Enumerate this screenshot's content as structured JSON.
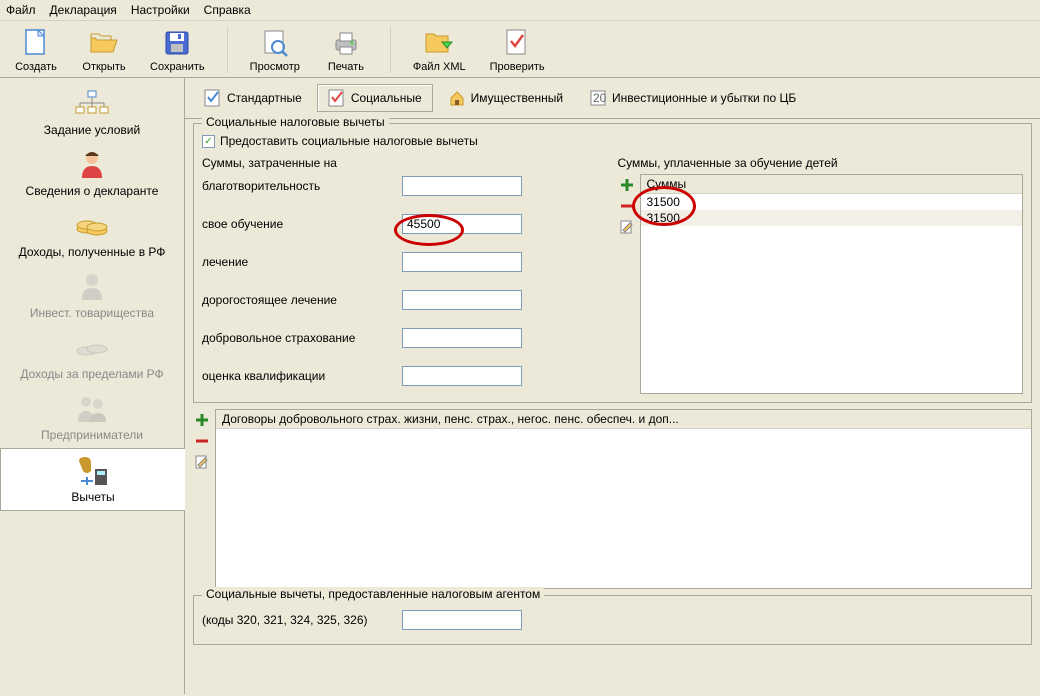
{
  "menubar": [
    "Файл",
    "Декларация",
    "Настройки",
    "Справка"
  ],
  "toolbar": [
    {
      "label": "Создать",
      "icon": "new-icon"
    },
    {
      "label": "Открыть",
      "icon": "open-icon"
    },
    {
      "label": "Сохранить",
      "icon": "save-icon"
    },
    {
      "label": "Просмотр",
      "icon": "preview-icon"
    },
    {
      "label": "Печать",
      "icon": "print-icon"
    },
    {
      "label": "Файл XML",
      "icon": "xml-icon"
    },
    {
      "label": "Проверить",
      "icon": "check-icon"
    }
  ],
  "sidebar": [
    {
      "label": "Задание условий",
      "icon": "conditions-icon",
      "enabled": true
    },
    {
      "label": "Сведения о декларанте",
      "icon": "declarant-icon",
      "enabled": true
    },
    {
      "label": "Доходы, полученные в РФ",
      "icon": "income-rf-icon",
      "enabled": true
    },
    {
      "label": "Инвест. товарищества",
      "icon": "invest-icon",
      "enabled": false
    },
    {
      "label": "Доходы за пределами РФ",
      "icon": "income-abroad-icon",
      "enabled": false
    },
    {
      "label": "Предприниматели",
      "icon": "entrepreneur-icon",
      "enabled": false
    },
    {
      "label": "Вычеты",
      "icon": "deductions-icon",
      "enabled": true,
      "selected": true
    }
  ],
  "tabs": [
    {
      "label": "Стандартные",
      "icon": "standard-icon"
    },
    {
      "label": "Социальные",
      "icon": "social-icon",
      "active": true
    },
    {
      "label": "Имущественный",
      "icon": "property-icon"
    },
    {
      "label": "Инвестиционные и убытки по ЦБ",
      "icon": "investment-icon"
    }
  ],
  "groupTitle": "Социальные налоговые вычеты",
  "checkboxLabel": "Предоставить социальные налоговые вычеты",
  "checkboxChecked": true,
  "sumsGroupTitle": "Суммы, затраченные на",
  "fields": [
    {
      "label": "благотворительность",
      "value": ""
    },
    {
      "label": "свое обучение",
      "value": "45500"
    },
    {
      "label": "лечение",
      "value": ""
    },
    {
      "label": "дорогостоящее лечение",
      "value": ""
    },
    {
      "label": "добровольное страхование",
      "value": ""
    },
    {
      "label": "оценка квалификации",
      "value": ""
    }
  ],
  "childrenGroupTitle": "Суммы, уплаченные за обучение детей",
  "childrenListHeader": "Суммы",
  "childrenList": [
    "31500",
    "31500"
  ],
  "contractsHeader": "Договоры добровольного страх. жизни, пенс. страх., негос. пенс. обеспеч. и доп...",
  "agentGroupTitle": "Социальные вычеты, предоставленные налоговым агентом",
  "agentCodesLabel": "(коды 320, 321, 324, 325, 326)",
  "toolbar_sep_after": [
    2,
    4
  ]
}
